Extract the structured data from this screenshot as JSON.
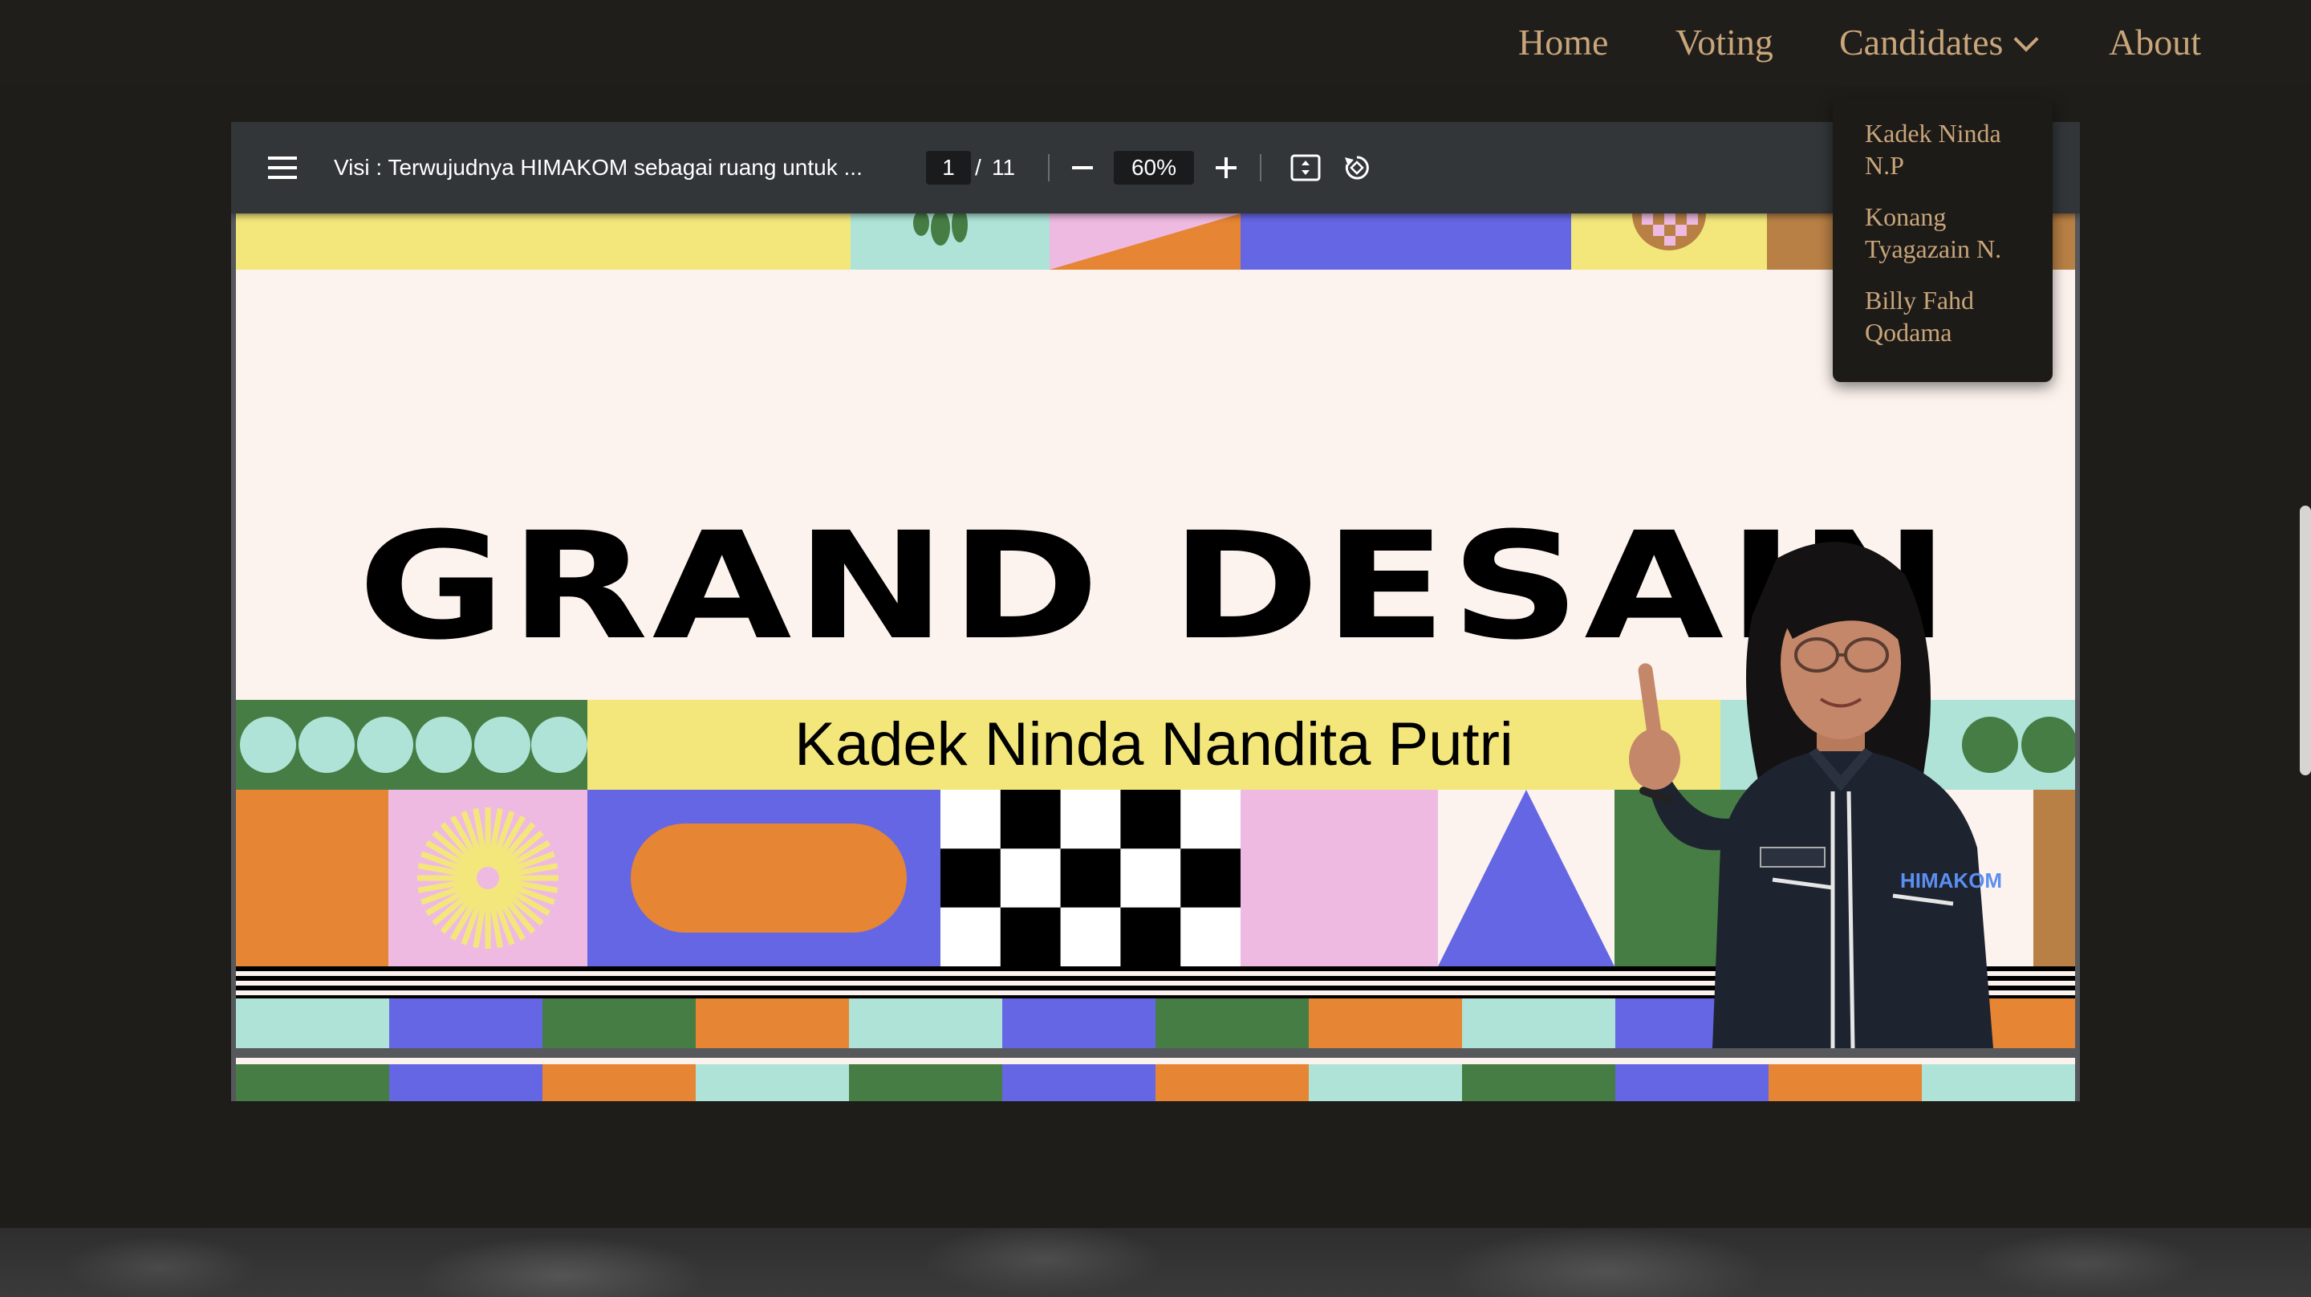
{
  "nav": {
    "home": "Home",
    "voting": "Voting",
    "candidates": "Candidates",
    "about": "About"
  },
  "dropdown": {
    "items": [
      {
        "line1": "Kadek Ninda",
        "line2": "N.P"
      },
      {
        "line1": "Konang",
        "line2": "Tyagazain N."
      },
      {
        "line1": "Billy Fahd",
        "line2": "Qodama"
      }
    ]
  },
  "pdf_toolbar": {
    "doc_title": "Visi : Terwujudnya HIMAKOM sebagai ruang untuk ...",
    "current_page": "1",
    "page_separator": "/",
    "total_pages": "11",
    "zoom": "60%"
  },
  "slide": {
    "title": "GRAND DESAIN",
    "candidate_name": "Kadek Ninda Nandita Putri",
    "shirt_text": "HIMAKOM"
  },
  "colors": {
    "background": "#1f1d1a",
    "nav_text": "#c9a57a",
    "toolbar": "#323639",
    "slide_bg": "#fdf3ee",
    "yellow": "#f3e77b",
    "mint": "#afe3d7",
    "blue": "#6566e4",
    "orange": "#e68533",
    "green": "#467d45",
    "pink": "#efbae2",
    "brown": "#b88045"
  }
}
